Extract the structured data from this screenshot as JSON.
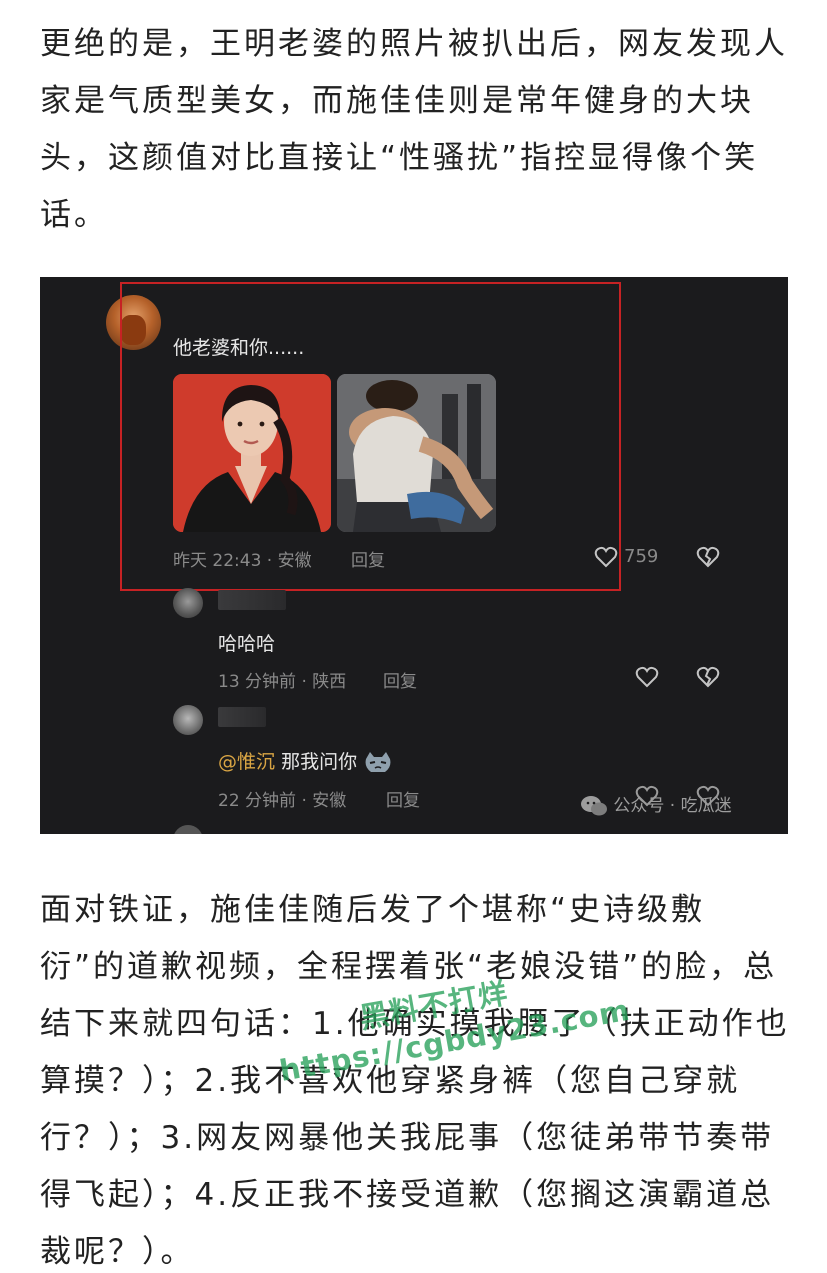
{
  "article": {
    "paragraph1": "更绝的是，王明老婆的照片被扒出后，网友发现人家是气质型美女，而施佳佳则是常年健身的大块头，这颜值对比直接让“性骚扰”指控显得像个笑话。",
    "paragraph2": "面对铁证，施佳佳随后发了个堪称“史诗级敷衍”的道歉视频，全程摆着张“老娘没错”的脸，总结下来就四句话：1.他确实摸我腰了（扶正动作也算摸？）；2.我不喜欢他穿紧身裤（您自己穿就行？）；3.网友网暴他关我屁事（您徒弟带节奏带得飞起）；4.反正我不接受道歉（您搁这演霸道总裁呢？）。"
  },
  "screenshot": {
    "main_comment": {
      "text": "他老婆和你......",
      "meta": "昨天 22:43 · 安徽",
      "reply_label": "回复",
      "like_count": "759"
    },
    "reply1": {
      "text": "哈哈哈",
      "meta": "13 分钟前 · 陕西",
      "reply_label": "回复"
    },
    "reply2": {
      "mention": "@惟沉",
      "text": "那我问你",
      "meta": "22 分钟前 · 安徽",
      "reply_label": "回复"
    },
    "source_watermark": "公众号 · 吃瓜迷"
  },
  "overlay_watermark": {
    "line1": "黑料不打烊",
    "line2": "https://cgbdy23.com"
  },
  "colors": {
    "highlight_border": "#c62224",
    "mention": "#d9a544",
    "panel_background": "#1b1b1d",
    "watermark_green": "#28a05a"
  }
}
